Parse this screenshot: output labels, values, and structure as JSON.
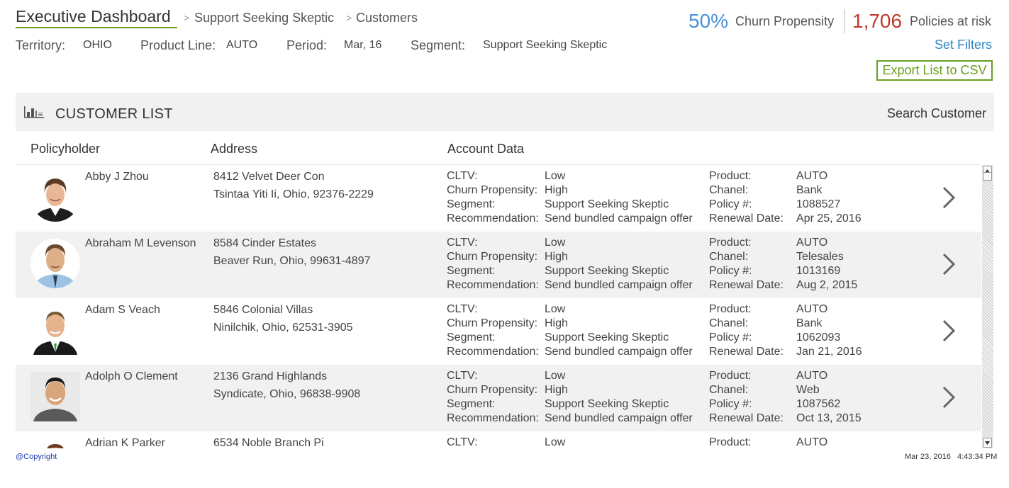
{
  "header": {
    "title": "Executive Dashboard",
    "breadcrumb_sep": ">",
    "breadcrumb": [
      "Support Seeking Skeptic",
      "Customers"
    ]
  },
  "filters": {
    "territory_label": "Territory:",
    "territory_value": "OHIO",
    "product_line_label": "Product Line:",
    "product_line_value": "AUTO",
    "period_label": "Period:",
    "period_value": "Mar, 16",
    "segment_label": "Segment:",
    "segment_value": "Support Seeking Skeptic"
  },
  "kpis": {
    "churn_value": "50%",
    "churn_label": "Churn Propensity",
    "policies_value": "1,706",
    "policies_label": "Policies at risk",
    "accent_blue": "#4a90d9",
    "accent_red": "#c0392b"
  },
  "actions": {
    "set_filters": "Set Filters",
    "export": "Export List to CSV"
  },
  "panel": {
    "title": "CUSTOMER LIST",
    "search": "Search Customer",
    "columns": [
      "Policyholder",
      "Address",
      "Account Data"
    ]
  },
  "field_labels": {
    "cltv": "CLTV:",
    "churn": "Churn Propensity:",
    "segment": "Segment:",
    "recommendation": "Recommendation:",
    "product": "Product:",
    "chanel": "Chanel:",
    "policy": "Policy #:",
    "renewal": "Renewal Date:"
  },
  "customers": [
    {
      "name": "Abby J Zhou",
      "addr1": "8412 Velvet Deer Con",
      "addr2": "Tsintaa Yiti Ii, Ohio, 92376-2229",
      "cltv": "Low",
      "churn": "High",
      "segment": "Support Seeking Skeptic",
      "recommendation": "Send bundled campaign offer",
      "product": "AUTO",
      "chanel": "Bank",
      "policy": "1088527",
      "renewal": "Apr 25, 2016"
    },
    {
      "name": "Abraham M Levenson",
      "addr1": "8584 Cinder Estates",
      "addr2": "Beaver Run, Ohio, 99631-4897",
      "cltv": "Low",
      "churn": "High",
      "segment": "Support Seeking Skeptic",
      "recommendation": "Send bundled campaign offer",
      "product": "AUTO",
      "chanel": "Telesales",
      "policy": "1013169",
      "renewal": "Aug 2, 2015"
    },
    {
      "name": "Adam S Veach",
      "addr1": "5846 Colonial Villas",
      "addr2": "Ninilchik, Ohio, 62531-3905",
      "cltv": "Low",
      "churn": "High",
      "segment": "Support Seeking Skeptic",
      "recommendation": "Send bundled campaign offer",
      "product": "AUTO",
      "chanel": "Bank",
      "policy": "1062093",
      "renewal": "Jan 21, 2016"
    },
    {
      "name": "Adolph O Clement",
      "addr1": "2136 Grand Highlands",
      "addr2": "Syndicate, Ohio, 96838-9908",
      "cltv": "Low",
      "churn": "High",
      "segment": "Support Seeking Skeptic",
      "recommendation": "Send bundled campaign offer",
      "product": "AUTO",
      "chanel": "Web",
      "policy": "1087562",
      "renewal": "Oct 13, 2015"
    },
    {
      "name": "Adrian K Parker",
      "addr1": "6534 Noble Branch Pi",
      "addr2": "",
      "cltv": "Low",
      "churn": "",
      "segment": "",
      "recommendation": "",
      "product": "AUTO",
      "chanel": "",
      "policy": "",
      "renewal": ""
    }
  ],
  "footer": {
    "copyright": "@Copyright",
    "date": "Mar 23, 2016",
    "time": "4:43:34 PM"
  }
}
